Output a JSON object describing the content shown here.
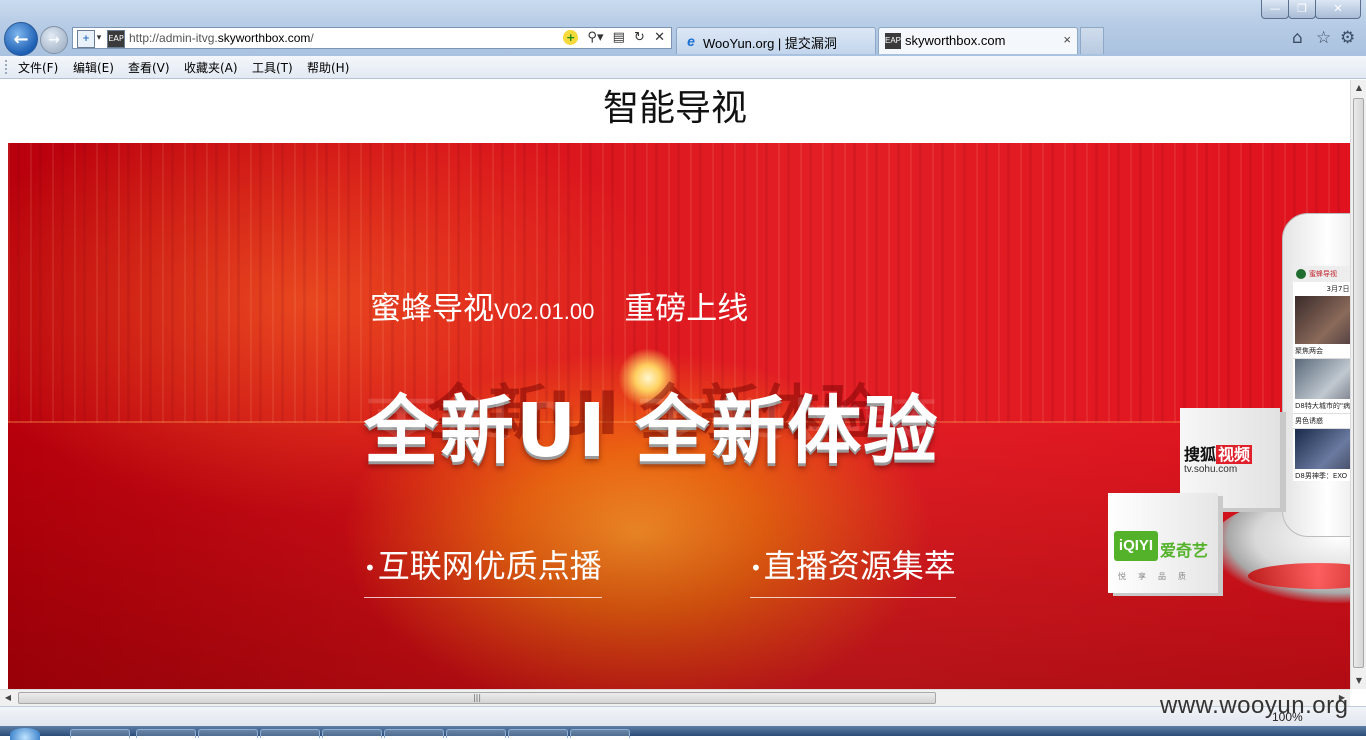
{
  "window": {
    "minimize": "—",
    "maximize": "❐",
    "close": "✕"
  },
  "nav": {
    "back_icon": "back-arrow-icon",
    "forward_icon": "forward-arrow-icon"
  },
  "address_bar": {
    "url_prefix": "http://admin-itvg.",
    "url_host": "skyworthbox.com",
    "url_suffix": "/",
    "site_badge": "EAP\n6"
  },
  "tabs": [
    {
      "title": "WooYun.org | 提交漏洞",
      "icon": "ie-icon"
    },
    {
      "title": "skyworthbox.com",
      "icon": "site-icon",
      "close": "×"
    }
  ],
  "menu": {
    "file": "文件(F)",
    "edit": "编辑(E)",
    "view": "查看(V)",
    "favorites": "收藏夹(A)",
    "tools": "工具(T)",
    "help": "帮助(H)"
  },
  "page": {
    "heading": "智能导视"
  },
  "banner": {
    "product_name": "蜜蜂导视",
    "version": "V02.01.00",
    "launch_text": "重磅上线",
    "slogan": "全新UI 全新体验",
    "features": [
      "互联网优质点播",
      "直播资源集萃"
    ],
    "sohu": {
      "name_plain": "搜狐",
      "name_highlight": "视频",
      "domain": "tv.sohu.com"
    },
    "iqiyi": {
      "logo": "iQIYI",
      "name": "爱奇艺",
      "tagline": "悦享品质"
    },
    "phone": {
      "app_title": "蜜蜂导视",
      "date": "3月7日",
      "caption_1": "聚焦两会",
      "caption_2": "D8特大城市的\"病根\"",
      "caption_3": "男色诱惑",
      "caption_4": "D8男神季：EXO"
    },
    "colors": {
      "banner_red": "#e31f25",
      "highlight_orange": "#f26a12",
      "iqiyi_green": "#54b22a",
      "sohu_red": "#e0202a"
    }
  },
  "status": {
    "zoom": "100%"
  },
  "watermark": "www.wooyun.org"
}
